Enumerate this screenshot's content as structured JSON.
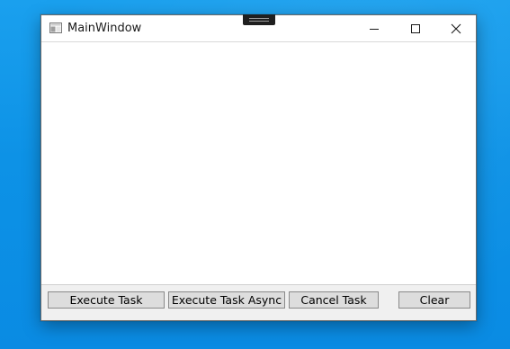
{
  "window": {
    "title": "MainWindow",
    "controls": {
      "minimize_icon": "minimize-icon",
      "maximize_icon": "maximize-icon",
      "close_icon": "close-icon"
    }
  },
  "buttons": {
    "execute_task": "Execute Task",
    "execute_task_async": "Execute Task Async",
    "cancel_task": "Cancel Task",
    "clear": "Clear"
  },
  "colors": {
    "desktop": "#0d92e6",
    "window_bg": "#f0f0f0",
    "button_bg": "#dddddd",
    "button_border": "#8a8a8a"
  }
}
